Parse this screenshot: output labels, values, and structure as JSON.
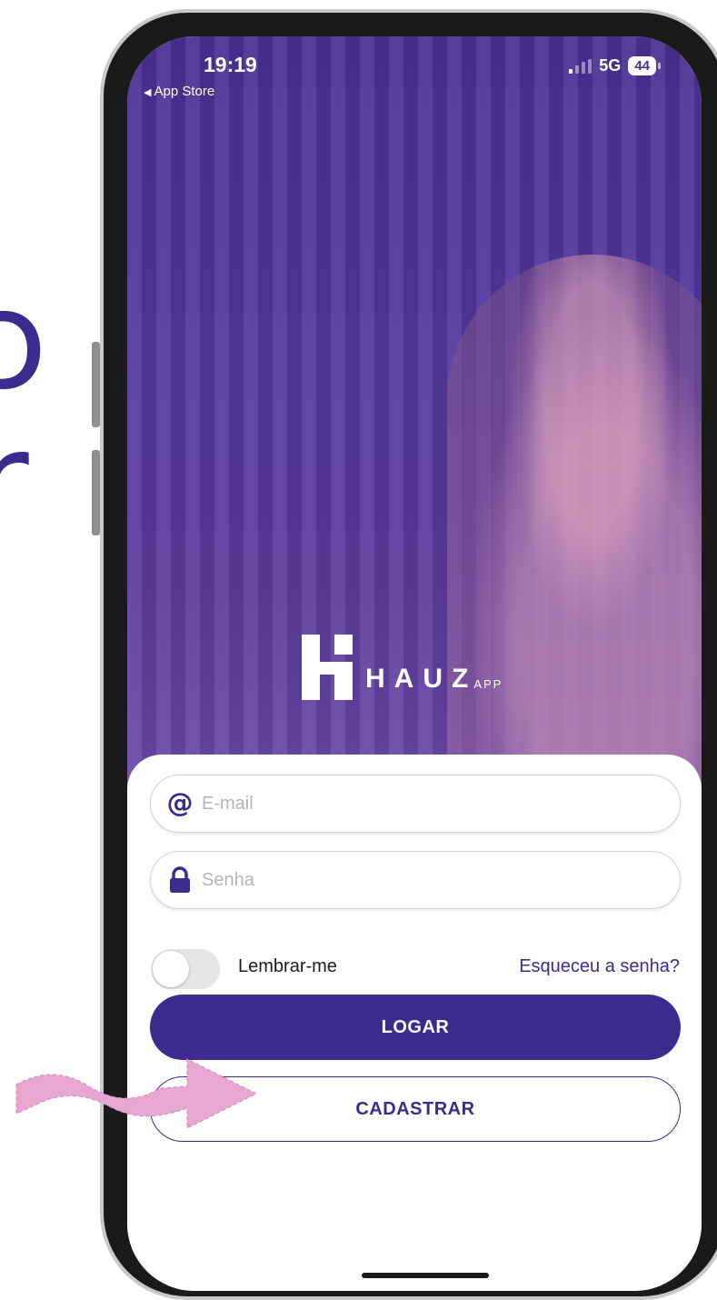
{
  "status_bar": {
    "time": "19:19",
    "back_label": "App Store",
    "network": "5G",
    "battery": "44"
  },
  "brand": {
    "name": "HAUZ",
    "suffix": "APP"
  },
  "form": {
    "email_placeholder": "E-mail",
    "password_placeholder": "Senha",
    "remember_label": "Lembrar-me",
    "remember_on": false,
    "forgot_label": "Esqueceu a senha?",
    "login_label": "LOGAR",
    "signup_label": "CADASTRAR"
  },
  "icons": {
    "email": "at-icon",
    "password": "lock-icon",
    "back": "back-triangle-icon"
  },
  "colors": {
    "accent": "#3b2b8f",
    "hero_overlay": "#4a2f93",
    "annotation_arrow": "#e8a7d0"
  }
}
